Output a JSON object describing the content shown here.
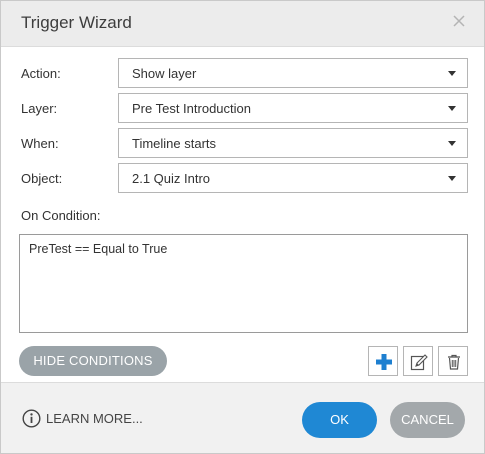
{
  "dialog": {
    "title": "Trigger Wizard",
    "close_icon": "close-icon"
  },
  "fields": [
    {
      "label": "Action:",
      "value": "Show layer"
    },
    {
      "label": "Layer:",
      "value": "Pre Test Introduction"
    },
    {
      "label": "When:",
      "value": "Timeline starts"
    },
    {
      "label": "Object:",
      "value": "2.1 Quiz Intro"
    }
  ],
  "conditions": {
    "label": "On Condition:",
    "items": [
      "PreTest == Equal to True"
    ],
    "hide_button": "HIDE CONDITIONS",
    "add_icon": "plus-icon",
    "edit_icon": "edit-icon",
    "delete_icon": "trash-icon"
  },
  "footer": {
    "learn_more": "LEARN MORE...",
    "info_icon": "info-icon",
    "ok": "OK",
    "cancel": "CANCEL"
  },
  "colors": {
    "primary": "#1f88d4",
    "secondary": "#a3a8ab",
    "add_icon": "#1d7fd0"
  }
}
